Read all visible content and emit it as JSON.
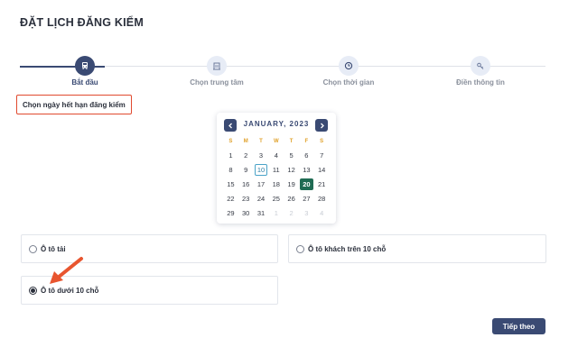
{
  "page": {
    "title": "ĐẶT LỊCH ĐĂNG KIỂM"
  },
  "stepper": {
    "steps": [
      {
        "label": "Bắt đầu",
        "icon": "car-icon",
        "active": true
      },
      {
        "label": "Chọn trung tâm",
        "icon": "building-icon",
        "active": false
      },
      {
        "label": "Chọn thời gian",
        "icon": "clock-icon",
        "active": false
      },
      {
        "label": "Điền thông tin",
        "icon": "key-icon",
        "active": false
      }
    ]
  },
  "date_picker": {
    "label": "Chọn ngày hết hạn đăng kiểm",
    "month_label": "JANUARY, 2023",
    "weekdays": [
      "S",
      "M",
      "T",
      "W",
      "T",
      "F",
      "S"
    ],
    "weeks": [
      [
        "1",
        "2",
        "3",
        "4",
        "5",
        "6",
        "7"
      ],
      [
        "8",
        "9",
        "10",
        "11",
        "12",
        "13",
        "14"
      ],
      [
        "15",
        "16",
        "17",
        "18",
        "19",
        "20",
        "21"
      ],
      [
        "22",
        "23",
        "24",
        "25",
        "26",
        "27",
        "28"
      ],
      [
        "29",
        "30",
        "31",
        "1",
        "2",
        "3",
        "4"
      ]
    ],
    "today": "10",
    "selected": "20"
  },
  "vehicle_options": {
    "truck": {
      "label": "Ô tô tải",
      "checked": false
    },
    "bus": {
      "label": "Ô tô khách trên 10 chỗ",
      "checked": false
    },
    "car": {
      "label": "Ô tô dưới 10 chỗ",
      "checked": true
    }
  },
  "actions": {
    "next_label": "Tiếp theo"
  },
  "colors": {
    "primary": "#3a4a73",
    "accent_highlight": "#e04a2f",
    "selected_day": "#1f6b53",
    "today_outline": "#4aa3c8",
    "weekday": "#e0a12a"
  }
}
